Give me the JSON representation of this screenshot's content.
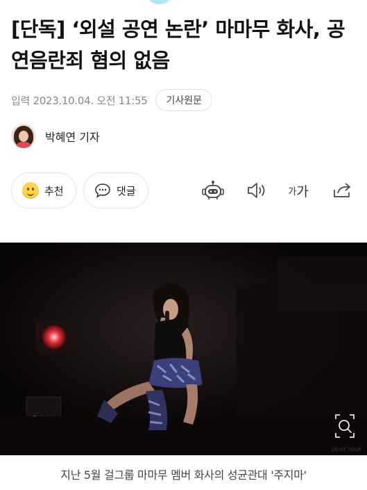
{
  "article": {
    "headline": "[단독] ‘외설 공연 논란’ 마마무 화사, 공연음란죄 혐의 없음",
    "date": "입력 2023.10.04. 오전 11:55",
    "original_label": "기사원문",
    "reporter": "박혜연 기자"
  },
  "actions": {
    "recommend_label": "추천",
    "comment_label": "댓글",
    "font_small": "가",
    "font_big": "가"
  },
  "photo": {
    "monitor_label": "Point",
    "corner_text": "DEVIT TOUR"
  },
  "caption": "지난 5월 걸그룹 마마무 멤버 화사의 성균관대 '주지마'",
  "colors": {
    "recommend_icon": "#ffd34d",
    "border": "#e4e4e4",
    "muted_text": "#888888"
  }
}
